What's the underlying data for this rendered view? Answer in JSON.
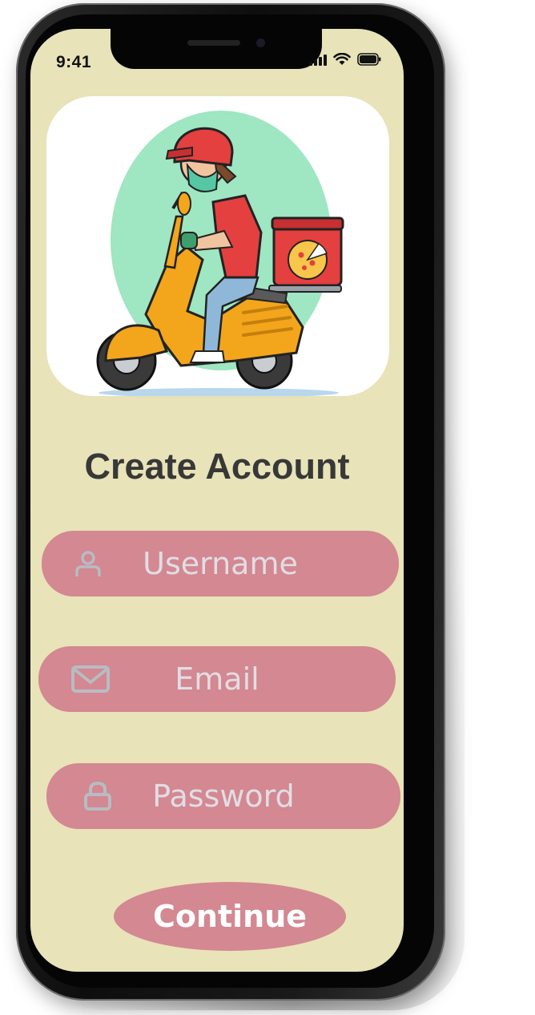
{
  "status_bar": {
    "time": "9:41"
  },
  "screen": {
    "title": "Create Account",
    "fields": {
      "username": {
        "placeholder": "Username",
        "icon": "person-icon"
      },
      "email": {
        "placeholder": "Email",
        "icon": "envelope-icon"
      },
      "password": {
        "placeholder": "Password",
        "icon": "lock-icon"
      }
    },
    "continue_label": "Continue"
  },
  "colors": {
    "background": "#e8e3b8",
    "field": "#d38892",
    "title": "#383838",
    "hero_circle": "#9fe6c2",
    "scooter": "#f3a51c",
    "rider_jacket": "#e3403f"
  }
}
